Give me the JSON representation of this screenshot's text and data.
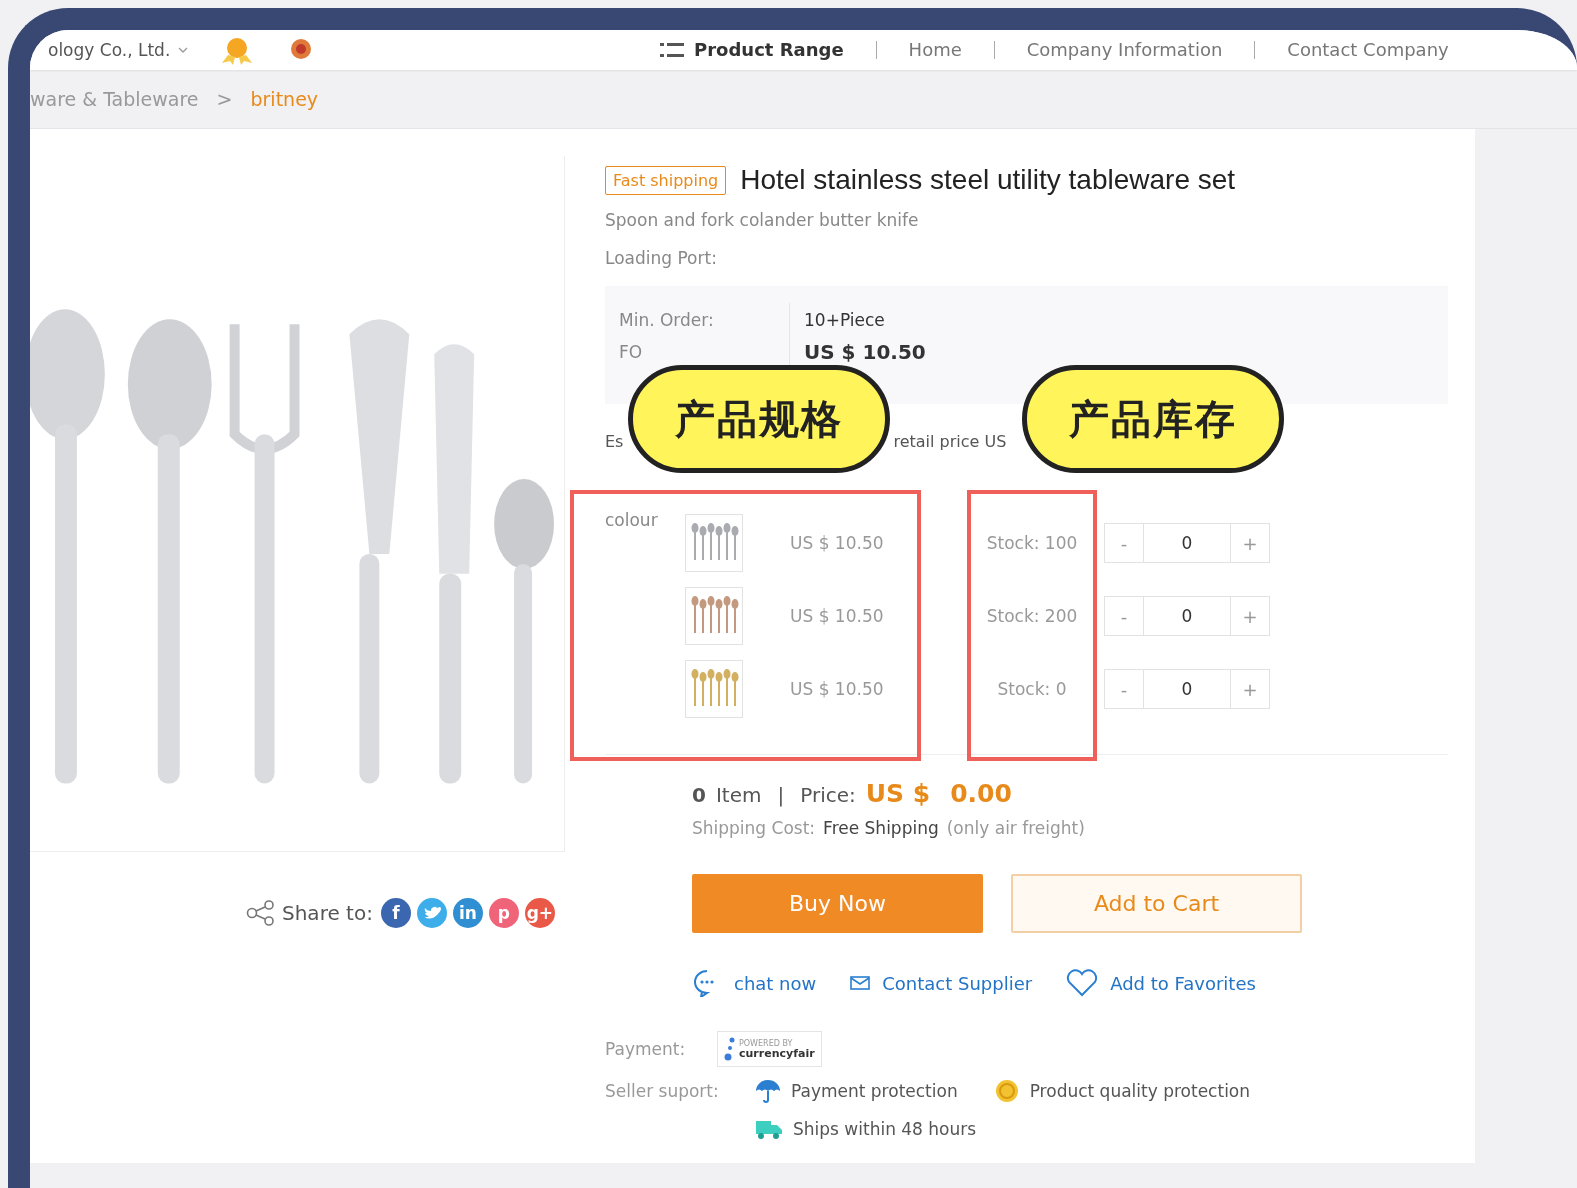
{
  "header": {
    "company": "ology Co., Ltd.",
    "nav": [
      {
        "label": "Product Range",
        "selected": true
      },
      {
        "label": "Home",
        "selected": false
      },
      {
        "label": "Company Information",
        "selected": false
      },
      {
        "label": "Contact Company",
        "selected": false
      }
    ]
  },
  "breadcrumb": {
    "separator": ">",
    "items": [
      {
        "label": "ware & Tableware",
        "current": false
      },
      {
        "label": "britney",
        "current": true
      }
    ]
  },
  "product": {
    "badge": "Fast shipping",
    "title": "Hotel stainless steel utility tableware set",
    "subtitle": "Spoon and fork colander butter knife",
    "loading_port": "Loading Port:",
    "specs": [
      {
        "label": "Min. Order:",
        "value": "10+Piece",
        "kind": "plain"
      },
      {
        "label": "FO",
        "value": "US $ 10.50",
        "kind": "price"
      }
    ],
    "retail": {
      "prefix": "Es",
      "suffix": "retail price US"
    }
  },
  "options": {
    "label": "colour",
    "rows": [
      {
        "color": "#a9abb0",
        "price": "US $ 10.50",
        "stock": "Stock: 100",
        "minus": "-",
        "quantity": "0",
        "plus": "+"
      },
      {
        "color": "#c39a80",
        "price": "US $ 10.50",
        "stock": "Stock: 200",
        "minus": "-",
        "quantity": "0",
        "plus": "+"
      },
      {
        "color": "#d2b060",
        "price": "US $ 10.50",
        "stock": "Stock: 0",
        "minus": "-",
        "quantity": "0",
        "plus": "+"
      }
    ]
  },
  "summary": {
    "count": "0",
    "item_label": "Item",
    "divider": "|",
    "price_label": "Price:",
    "currency": "US $",
    "amount": "0.00",
    "shipping_label": "Shipping Cost:",
    "shipping_value": "Free Shipping",
    "shipping_note": "(only air freight)"
  },
  "share": {
    "label": "Share to:",
    "networks": [
      {
        "kind": "facebook",
        "glyph": "f",
        "color": "#3b66b0"
      },
      {
        "kind": "twitter",
        "color": "#3daeea"
      },
      {
        "kind": "linkedin",
        "glyph": "in",
        "color": "#2f8fd2"
      },
      {
        "kind": "pinterest",
        "glyph": "p",
        "color": "#f0647a"
      },
      {
        "kind": "google",
        "glyph": "g+",
        "color": "#ea5848"
      }
    ]
  },
  "buttons": [
    {
      "kind": "primary",
      "label": "Buy Now"
    },
    {
      "kind": "secondary",
      "label": "Add to Cart"
    }
  ],
  "links": [
    {
      "kind": "chat",
      "label": "chat now"
    },
    {
      "kind": "mail",
      "label": "Contact Supplier"
    },
    {
      "kind": "heart",
      "label": "Add to Favorites"
    }
  ],
  "payment": {
    "label": "Payment:",
    "logo_caption": "POWERED BY",
    "logo_text": "currencyfair"
  },
  "seller_support": {
    "label": "Seller suport:",
    "items": [
      {
        "kind": "umbrella",
        "label": "Payment protection"
      },
      {
        "kind": "medal",
        "label": "Product quality protection"
      },
      {
        "kind": "truck",
        "label": "Ships within 48 hours"
      }
    ]
  },
  "callouts": [
    {
      "text": "产品规格"
    },
    {
      "text": "产品库存"
    }
  ]
}
